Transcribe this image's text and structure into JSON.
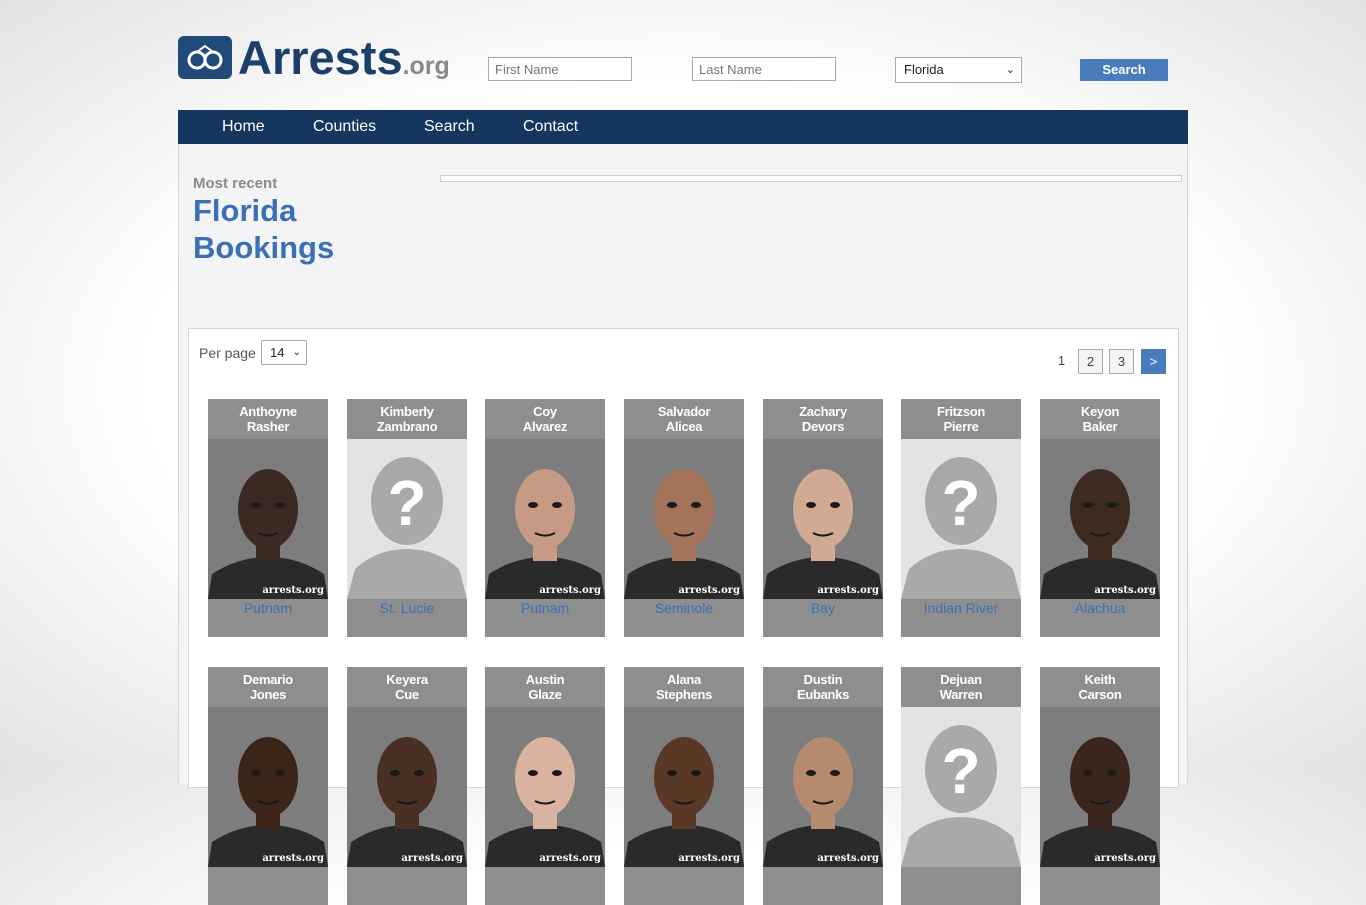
{
  "header": {
    "logo_main": "Arrests",
    "logo_suffix": ".org",
    "first_name_placeholder": "First Name",
    "last_name_placeholder": "Last Name",
    "state_selected": "Florida",
    "search_label": "Search"
  },
  "nav": {
    "items": [
      {
        "label": "Home"
      },
      {
        "label": "Counties"
      },
      {
        "label": "Search"
      },
      {
        "label": "Contact"
      }
    ]
  },
  "heading": {
    "kicker": "Most recent",
    "title_line1": "Florida",
    "title_line2": "Bookings"
  },
  "listing": {
    "per_page_label": "Per page",
    "per_page_value": "14",
    "pages": [
      "1",
      "2",
      "3",
      ">"
    ],
    "watermark": "arrests.org",
    "colors": {
      "accent": "#4a7bbd",
      "nav": "#15365e",
      "card": "#8e8e8e",
      "link": "#3a71b8"
    },
    "people": [
      {
        "first": "Anthoyne",
        "last": "Rasher",
        "county": "Putnam",
        "photo": "mugshot",
        "skin": "#3a2a22"
      },
      {
        "first": "Kimberly",
        "last": "Zambrano",
        "county": "St. Lucie",
        "photo": "placeholder"
      },
      {
        "first": "Coy",
        "last": "Alvarez",
        "county": "Putnam",
        "photo": "mugshot",
        "skin": "#c79a85"
      },
      {
        "first": "Salvador",
        "last": "Alicea",
        "county": "Seminole",
        "photo": "mugshot",
        "skin": "#a4735a"
      },
      {
        "first": "Zachary",
        "last": "Devors",
        "county": "Bay",
        "photo": "mugshot",
        "skin": "#d2aa94"
      },
      {
        "first": "Fritzson",
        "last": "Pierre",
        "county": "Indian River",
        "photo": "placeholder"
      },
      {
        "first": "Keyon",
        "last": "Baker",
        "county": "Alachua",
        "photo": "mugshot",
        "skin": "#3d2a20"
      },
      {
        "first": "Demario",
        "last": "Jones",
        "county": "",
        "photo": "mugshot",
        "skin": "#3b2519"
      },
      {
        "first": "Keyera",
        "last": "Cue",
        "county": "",
        "photo": "mugshot",
        "skin": "#4a3024"
      },
      {
        "first": "Austin",
        "last": "Glaze",
        "county": "",
        "photo": "mugshot",
        "skin": "#d9b3a0"
      },
      {
        "first": "Alana",
        "last": "Stephens",
        "county": "",
        "photo": "mugshot",
        "skin": "#5a3826"
      },
      {
        "first": "Dustin",
        "last": "Eubanks",
        "county": "",
        "photo": "mugshot",
        "skin": "#b58a6e"
      },
      {
        "first": "Dejuan",
        "last": "Warren",
        "county": "",
        "photo": "placeholder"
      },
      {
        "first": "Keith",
        "last": "Carson",
        "county": "",
        "photo": "mugshot",
        "skin": "#3a261c"
      }
    ]
  }
}
